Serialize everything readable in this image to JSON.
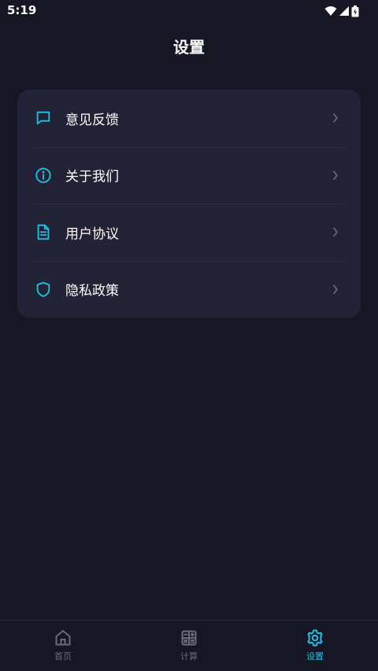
{
  "status_bar": {
    "time": "5:19"
  },
  "header": {
    "title": "设置"
  },
  "menu": {
    "items": [
      {
        "label": "意见反馈",
        "icon": "message-icon"
      },
      {
        "label": "关于我们",
        "icon": "info-icon"
      },
      {
        "label": "用户协议",
        "icon": "document-icon"
      },
      {
        "label": "隐私政策",
        "icon": "shield-icon"
      }
    ]
  },
  "tabbar": {
    "tabs": [
      {
        "label": "首页",
        "icon": "home-icon",
        "active": false
      },
      {
        "label": "计算",
        "icon": "calculator-icon",
        "active": false
      },
      {
        "label": "设置",
        "icon": "gear-icon",
        "active": true
      }
    ]
  },
  "colors": {
    "background": "#161625",
    "card": "#232338",
    "accent": "#1fc3e6",
    "inactive": "#6b6b7e"
  }
}
